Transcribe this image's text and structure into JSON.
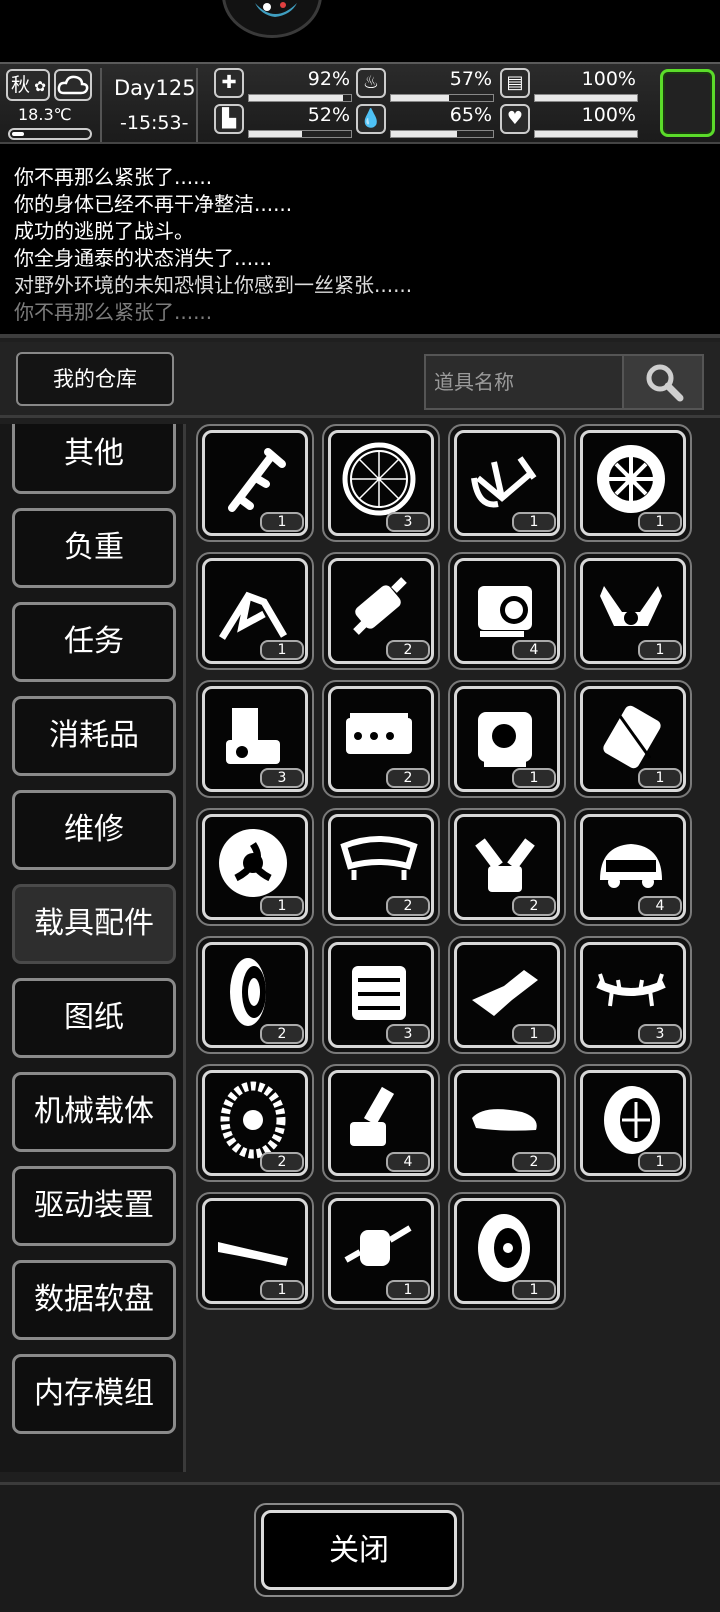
{
  "status": {
    "season": "秋",
    "temperature": "18.3℃",
    "temperature_level": 0.15,
    "day": "Day125",
    "clock": "-15:53-",
    "stats": [
      {
        "icon": "medkit-icon",
        "glyph": "✚",
        "value": "92%",
        "level": 0.92
      },
      {
        "icon": "stomach-icon",
        "glyph": "♨",
        "value": "57%",
        "level": 0.57
      },
      {
        "icon": "battery-icon",
        "glyph": "▤",
        "value": "100%",
        "level": 1.0
      },
      {
        "icon": "boot-icon",
        "glyph": "▙",
        "value": "52%",
        "level": 0.52
      },
      {
        "icon": "water-drop-icon",
        "glyph": "💧",
        "value": "65%",
        "level": 0.65
      },
      {
        "icon": "heart-icon",
        "glyph": "♥",
        "value": "100%",
        "level": 1.0
      }
    ],
    "highlight_color": "#5bdc2a"
  },
  "log": [
    "你不再那么紧张了......",
    "你的身体已经不再干净整洁......",
    "成功的逃脱了战斗。",
    "你全身通泰的状态消失了......",
    "对野外环境的未知恐惧让你感到一丝紧张......",
    "你不再那么紧张了......"
  ],
  "panel": {
    "title": "我的仓库",
    "search_placeholder": "道具名称",
    "categories": [
      "其他",
      "负重",
      "任务",
      "消耗品",
      "维修",
      "载具配件",
      "图纸",
      "机械载体",
      "驱动装置",
      "数据软盘",
      "内存模组"
    ],
    "active_category": "载具配件",
    "items": [
      {
        "icon": "fuel-injector-icon",
        "count": "1"
      },
      {
        "icon": "bicycle-wheel-icon",
        "count": "3"
      },
      {
        "icon": "bike-frame-icon",
        "count": "1"
      },
      {
        "icon": "offroad-wheel-icon",
        "count": "1"
      },
      {
        "icon": "swingarm-frame-icon",
        "count": "1"
      },
      {
        "icon": "shock-absorber-icon",
        "count": "2"
      },
      {
        "icon": "engine-block-icon",
        "count": "4"
      },
      {
        "icon": "v-twin-engine-icon",
        "count": "1"
      },
      {
        "icon": "motorcycle-engine-icon",
        "count": "3"
      },
      {
        "icon": "inline-engine-icon",
        "count": "2"
      },
      {
        "icon": "car-engine-icon",
        "count": "1"
      },
      {
        "icon": "motor-cylinder-icon",
        "count": "1"
      },
      {
        "icon": "turbine-wheel-icon",
        "count": "1"
      },
      {
        "icon": "bumper-icon",
        "count": "2"
      },
      {
        "icon": "v-engine-icon",
        "count": "2"
      },
      {
        "icon": "car-body-icon",
        "count": "4"
      },
      {
        "icon": "tire-icon",
        "count": "2"
      },
      {
        "icon": "engine-assembly-icon",
        "count": "3"
      },
      {
        "icon": "fender-icon",
        "count": "1"
      },
      {
        "icon": "spiked-bar-icon",
        "count": "3"
      },
      {
        "icon": "chained-wheel-icon",
        "count": "2"
      },
      {
        "icon": "drive-shaft-icon",
        "count": "4"
      },
      {
        "icon": "roof-box-icon",
        "count": "2"
      },
      {
        "icon": "sport-wheel-icon",
        "count": "1"
      },
      {
        "icon": "spoiler-icon",
        "count": "1"
      },
      {
        "icon": "motor-icon",
        "count": "1"
      },
      {
        "icon": "spare-tire-icon",
        "count": "1"
      }
    ],
    "close_label": "关闭"
  }
}
